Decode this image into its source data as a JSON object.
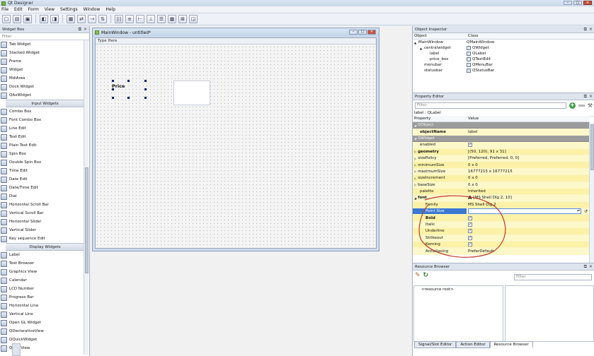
{
  "window": {
    "title": "Qt Designer"
  },
  "menu": [
    "File",
    "Edit",
    "Form",
    "View",
    "Settings",
    "Window",
    "Help"
  ],
  "widget_box": {
    "title": "Widget Box",
    "filter_placeholder": "Filter",
    "items": [
      {
        "type": "item",
        "label": "Tab Widget",
        "icon": "tab-widget-icon"
      },
      {
        "type": "item",
        "label": "Stacked Widget",
        "icon": "stacked-widget-icon"
      },
      {
        "type": "item",
        "label": "Frame",
        "icon": "frame-icon"
      },
      {
        "type": "item",
        "label": "Widget",
        "icon": "widget-icon"
      },
      {
        "type": "item",
        "label": "MdiArea",
        "icon": "mdi-area-icon"
      },
      {
        "type": "item",
        "label": "Dock Widget",
        "icon": "dock-widget-icon"
      },
      {
        "type": "item",
        "label": "QAxWidget",
        "icon": "qax-widget-icon"
      },
      {
        "type": "category",
        "label": "Input Widgets"
      },
      {
        "type": "item",
        "label": "Combo Box",
        "icon": "combo-box-icon"
      },
      {
        "type": "item",
        "label": "Font Combo Box",
        "icon": "font-combo-box-icon"
      },
      {
        "type": "item",
        "label": "Line Edit",
        "icon": "line-edit-icon"
      },
      {
        "type": "item",
        "label": "Text Edit",
        "icon": "text-edit-icon"
      },
      {
        "type": "item",
        "label": "Plain Text Edit",
        "icon": "plain-text-edit-icon"
      },
      {
        "type": "item",
        "label": "Spin Box",
        "icon": "spin-box-icon"
      },
      {
        "type": "item",
        "label": "Double Spin Box",
        "icon": "double-spin-box-icon"
      },
      {
        "type": "item",
        "label": "Time Edit",
        "icon": "time-edit-icon"
      },
      {
        "type": "item",
        "label": "Date Edit",
        "icon": "date-edit-icon"
      },
      {
        "type": "item",
        "label": "Date/Time Edit",
        "icon": "datetime-edit-icon"
      },
      {
        "type": "item",
        "label": "Dial",
        "icon": "dial-icon"
      },
      {
        "type": "item",
        "label": "Horizontal Scroll Bar",
        "icon": "hscrollbar-icon"
      },
      {
        "type": "item",
        "label": "Vertical Scroll Bar",
        "icon": "vscrollbar-icon"
      },
      {
        "type": "item",
        "label": "Horizontal Slider",
        "icon": "hslider-icon"
      },
      {
        "type": "item",
        "label": "Vertical Slider",
        "icon": "vslider-icon"
      },
      {
        "type": "item",
        "label": "Key sequence Edit",
        "icon": "key-sequence-icon"
      },
      {
        "type": "category",
        "label": "Display Widgets"
      },
      {
        "type": "item",
        "label": "Label",
        "icon": "label-icon"
      },
      {
        "type": "item",
        "label": "Text Browser",
        "icon": "text-browser-icon"
      },
      {
        "type": "item",
        "label": "Graphics View",
        "icon": "graphics-view-icon"
      },
      {
        "type": "item",
        "label": "Calendar",
        "icon": "calendar-icon"
      },
      {
        "type": "item",
        "label": "LCD Number",
        "icon": "lcd-number-icon"
      },
      {
        "type": "item",
        "label": "Progress Bar",
        "icon": "progress-bar-icon"
      },
      {
        "type": "item",
        "label": "Horizontal Line",
        "icon": "hline-icon"
      },
      {
        "type": "item",
        "label": "Vertical Line",
        "icon": "vline-icon"
      },
      {
        "type": "item",
        "label": "Open GL Widget",
        "icon": "opengl-icon"
      },
      {
        "type": "item",
        "label": "QDeclarativeView",
        "icon": "declarative-view-icon"
      },
      {
        "type": "item",
        "label": "QQuickWidget",
        "icon": "quick-widget-icon"
      },
      {
        "type": "item",
        "label": "QWebView",
        "icon": "web-view-icon"
      }
    ]
  },
  "form_window": {
    "title": "MainWindow - untitled*",
    "menubar_placeholder": "Type Here",
    "label_text": "Price"
  },
  "object_inspector": {
    "title": "Object Inspector",
    "columns": [
      "Object",
      "Class"
    ],
    "rows": [
      {
        "object": "MainWindow",
        "class": "QMainWindow",
        "indent": 0,
        "arrow": "▲"
      },
      {
        "object": "centralwidget",
        "class": "QWidget",
        "indent": 1,
        "arrow": "▲"
      },
      {
        "object": "label",
        "class": "QLabel",
        "indent": 2,
        "arrow": ""
      },
      {
        "object": "price_box",
        "class": "QTextEdit",
        "indent": 2,
        "arrow": ""
      },
      {
        "object": "menubar",
        "class": "QMenuBar",
        "indent": 1,
        "arrow": ""
      },
      {
        "object": "statusbar",
        "class": "QStatusBar",
        "indent": 1,
        "arrow": ""
      }
    ]
  },
  "property_editor": {
    "title": "Property Editor",
    "filter_placeholder": "Filter",
    "subtitle": "label : QLabel",
    "columns": [
      "Property",
      "Value"
    ],
    "rows": [
      {
        "kind": "cat",
        "prop": "QObject",
        "value": ""
      },
      {
        "kind": "y1",
        "prop": "objectName",
        "value": "label",
        "bold": true
      },
      {
        "kind": "cat",
        "prop": "QWidget",
        "value": ""
      },
      {
        "kind": "y1",
        "prop": "enabled",
        "value": "",
        "checkbox": true
      },
      {
        "kind": "y2",
        "prop": "geometry",
        "value": "[(50, 120), 91 x 31]",
        "bold": true,
        "expand": true
      },
      {
        "kind": "y1",
        "prop": "sizePolicy",
        "value": "[Preferred, Preferred, 0, 0]",
        "expand": true
      },
      {
        "kind": "y2",
        "prop": "minimumSize",
        "value": "0 x 0",
        "expand": true
      },
      {
        "kind": "y1",
        "prop": "maximumSize",
        "value": "16777215 x 16777215",
        "expand": true
      },
      {
        "kind": "y2",
        "prop": "sizeIncrement",
        "value": "0 x 0",
        "expand": true
      },
      {
        "kind": "y1",
        "prop": "baseSize",
        "value": "0 x 0",
        "expand": true
      },
      {
        "kind": "y2",
        "prop": "palette",
        "value": "Inherited"
      },
      {
        "kind": "y1",
        "prop": "font",
        "value": "[MS Shell Dlg 2, 10]",
        "bold": true,
        "open": true
      },
      {
        "kind": "y2",
        "prop": "Family",
        "value": "MS Shell Dlg 2",
        "indent": true
      },
      {
        "kind": "sel",
        "prop": "Point Size",
        "value": "",
        "indent": true
      },
      {
        "kind": "y2",
        "prop": "Bold",
        "value": "",
        "indent": true,
        "bold": true,
        "checkbox": true
      },
      {
        "kind": "y1",
        "prop": "Italic",
        "value": "",
        "indent": true,
        "checkbox": true
      },
      {
        "kind": "y2",
        "prop": "Underline",
        "value": "",
        "indent": true,
        "checkbox": true
      },
      {
        "kind": "y1",
        "prop": "Strikeout",
        "value": "",
        "indent": true,
        "checkbox": true
      },
      {
        "kind": "y2",
        "prop": "Kerning",
        "value": "",
        "indent": true,
        "checkbox": true
      },
      {
        "kind": "y1",
        "prop": "Antialiasing",
        "value": "PreferDefault",
        "indent": true
      }
    ]
  },
  "resource_browser": {
    "title": "Resource Browser",
    "filter_placeholder": "Filter",
    "root_item": "<resource root>"
  },
  "bottom_tabs": [
    "Signal/Slot Editor",
    "Action Editor",
    "Resource Browser"
  ],
  "colors": {
    "category_row": "#9c9c9c",
    "property_row_light": "#fdf8c9",
    "property_row_dark": "#fbf2a7",
    "selection": "#3a78d1",
    "annotation": "#c0392b"
  }
}
